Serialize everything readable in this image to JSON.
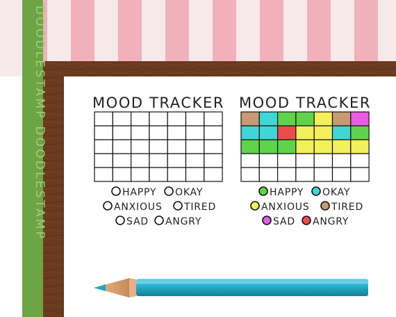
{
  "brand": {
    "vertical_text": "DOODLESTAMP DOODLESTAMP"
  },
  "colors": {
    "stripe_pink": "#f0a7b2",
    "stripe_light": "#f7e8ea",
    "wood": "#6b3a1f",
    "green_band": "#6da545",
    "pencil": "#2ab3cf",
    "grid_line": "#111111",
    "moods": {
      "happy": "#5fd44a",
      "okay": "#3fd6d6",
      "anxious": "#f2f05b",
      "tired": "#c79a74",
      "sad": "#e85ce8",
      "angry": "#ef4b4b"
    }
  },
  "left_tracker": {
    "title": "MOOD TRACKER",
    "cols": 7,
    "rows": 5,
    "legend": [
      {
        "key": "happy",
        "label": "HAPPY"
      },
      {
        "key": "okay",
        "label": "OKAY"
      },
      {
        "key": "anxious",
        "label": "ANXIOUS"
      },
      {
        "key": "tired",
        "label": "TIRED"
      },
      {
        "key": "sad",
        "label": "SAD"
      },
      {
        "key": "angry",
        "label": "ANGRY"
      }
    ]
  },
  "right_tracker": {
    "title": "MOOD TRACKER",
    "cols": 7,
    "rows": 5,
    "filled_grid": [
      [
        "tired",
        "okay",
        "happy",
        "happy",
        "anxious",
        "tired",
        "sad"
      ],
      [
        "okay",
        "okay",
        "angry",
        "anxious",
        "anxious",
        "okay",
        "happy"
      ],
      [
        "happy",
        "happy",
        "happy",
        "anxious",
        "anxious",
        "anxious",
        "anxious"
      ],
      [
        "",
        "",
        "",
        "",
        "",
        "",
        ""
      ],
      [
        "",
        "",
        "",
        "",
        "",
        "",
        ""
      ]
    ],
    "legend": [
      {
        "key": "happy",
        "label": "HAPPY"
      },
      {
        "key": "okay",
        "label": "OKAY"
      },
      {
        "key": "anxious",
        "label": "ANXIOUS"
      },
      {
        "key": "tired",
        "label": "TIRED"
      },
      {
        "key": "sad",
        "label": "SAD"
      },
      {
        "key": "angry",
        "label": "ANGRY"
      }
    ]
  }
}
